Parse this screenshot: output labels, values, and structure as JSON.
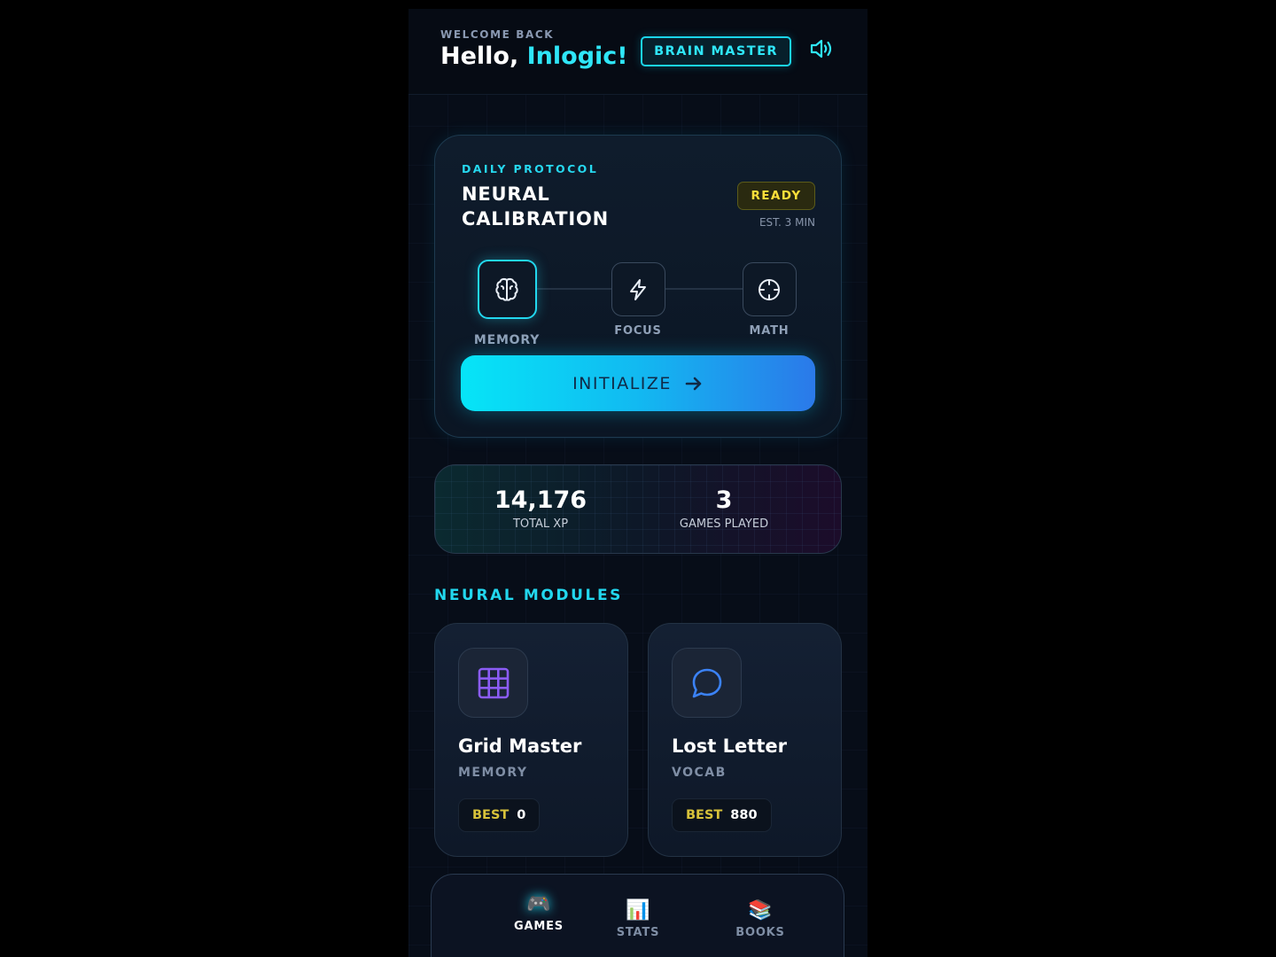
{
  "header": {
    "welcome": "WELCOME BACK",
    "greeting_prefix": "Hello, ",
    "user_name": "Inlogic!",
    "rank_badge": "BRAIN MASTER",
    "sound_icon": "speaker-volume-icon"
  },
  "daily": {
    "kicker": "DAILY PROTOCOL",
    "title": "NEURAL CALIBRATION",
    "status": "READY",
    "estimate": "EST. 3 MIN",
    "stages": [
      {
        "label": "MEMORY",
        "icon": "brain-icon",
        "active": true
      },
      {
        "label": "FOCUS",
        "icon": "lightning-icon",
        "active": false
      },
      {
        "label": "MATH",
        "icon": "crosshair-icon",
        "active": false
      }
    ],
    "button_label": "INITIALIZE",
    "button_icon": "arrow-right-icon"
  },
  "stats": {
    "xp_value": "14,176",
    "xp_label": "TOTAL XP",
    "games_value": "3",
    "games_label": "GAMES PLAYED"
  },
  "modules": {
    "title": "NEURAL MODULES",
    "items": [
      {
        "name": "Grid Master",
        "category": "MEMORY",
        "best_label": "BEST",
        "best_value": "0",
        "icon": "grid-icon",
        "icon_color": "#8b5cf6"
      },
      {
        "name": "Lost Letter",
        "category": "VOCAB",
        "best_label": "BEST",
        "best_value": "880",
        "icon": "chat-bubble-icon",
        "icon_color": "#3b82f6"
      }
    ]
  },
  "nav": {
    "items": [
      {
        "label": "GAMES",
        "icon": "🎮",
        "icon_name": "gamepad-icon",
        "active": true
      },
      {
        "label": "STATS",
        "icon": "📊",
        "icon_name": "bar-chart-icon",
        "active": false
      },
      {
        "label": "BOOKS",
        "icon": "📚",
        "icon_name": "books-icon",
        "active": false
      }
    ]
  },
  "colors": {
    "accent": "#22d7ee",
    "ready": "#ffe03a",
    "best": "#d8c23a",
    "background": "#070d18"
  }
}
